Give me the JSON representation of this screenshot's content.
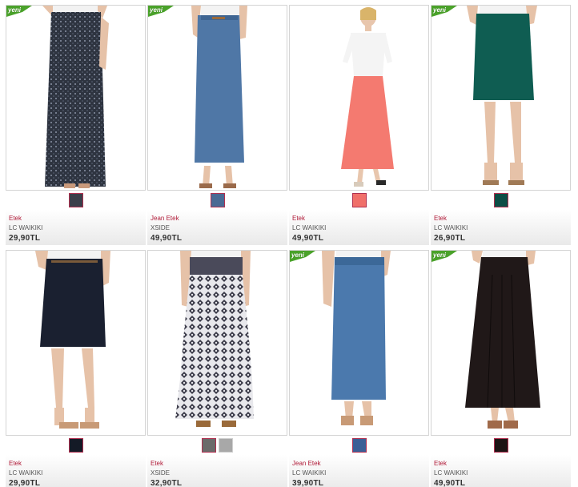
{
  "new_badge": "yeni",
  "products": [
    {
      "category": "Etek",
      "brand": "LC WAIKIKI",
      "price": "29,90TL",
      "badge": true,
      "skirt": "dark-print",
      "swatches": [
        "#3a3f4a"
      ]
    },
    {
      "category": "Jean Etek",
      "brand": "XSIDE",
      "price": "49,90TL",
      "badge": true,
      "skirt": "denim",
      "swatches": [
        "#4a6a94"
      ]
    },
    {
      "category": "Etek",
      "brand": "LC WAIKIKI",
      "price": "49,90TL",
      "badge": false,
      "skirt": "coral",
      "swatches": [
        "#f0706a"
      ]
    },
    {
      "category": "Etek",
      "brand": "LC WAIKIKI",
      "price": "26,90TL",
      "badge": true,
      "skirt": "green",
      "swatches": [
        "#0d4e46"
      ]
    },
    {
      "category": "Etek",
      "brand": "LC WAIKIKI",
      "price": "29,90TL",
      "badge": false,
      "skirt": "navy",
      "swatches": [
        "#141a26"
      ]
    },
    {
      "category": "Etek",
      "brand": "XSIDE",
      "price": "32,90TL",
      "badge": false,
      "skirt": "tiered-print",
      "swatches": [
        "#6a6a6a",
        "#a8a8a8"
      ]
    },
    {
      "category": "Jean Etek",
      "brand": "LC WAIKIKI",
      "price": "39,90TL",
      "badge": true,
      "skirt": "denim-long",
      "swatches": [
        "#3a5f96"
      ]
    },
    {
      "category": "Etek",
      "brand": "LC WAIKIKI",
      "price": "49,90TL",
      "badge": true,
      "skirt": "black-pleat",
      "swatches": [
        "#1c1414"
      ]
    }
  ]
}
